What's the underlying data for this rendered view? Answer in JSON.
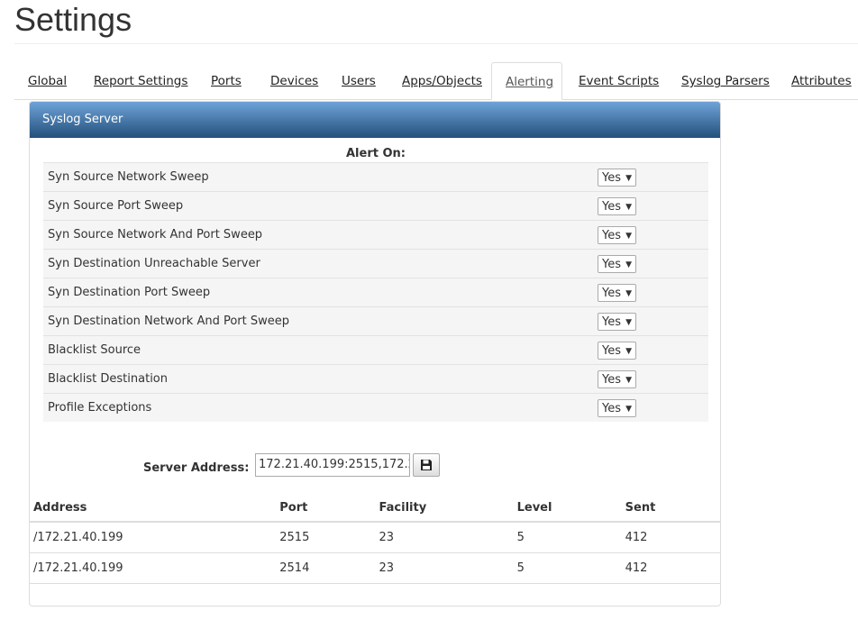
{
  "page_title": "Settings",
  "tabs": [
    "Global",
    "Report Settings",
    "Ports",
    "Devices",
    "Users",
    "Apps/Objects",
    "Alerting",
    "Event Scripts",
    "Syslog Parsers",
    "Attributes"
  ],
  "active_tab": "Alerting",
  "panel": {
    "title": "Syslog Server",
    "alert_on_label": "Alert On:",
    "alerts": [
      {
        "label": "Syn Source Network Sweep",
        "value": "Yes"
      },
      {
        "label": "Syn Source Port Sweep",
        "value": "Yes"
      },
      {
        "label": "Syn Source Network And Port Sweep",
        "value": "Yes"
      },
      {
        "label": "Syn Destination Unreachable Server",
        "value": "Yes"
      },
      {
        "label": "Syn Destination Port Sweep",
        "value": "Yes"
      },
      {
        "label": "Syn Destination Network And Port Sweep",
        "value": "Yes"
      },
      {
        "label": "Blacklist Source",
        "value": "Yes"
      },
      {
        "label": "Blacklist Destination",
        "value": "Yes"
      },
      {
        "label": "Profile Exceptions",
        "value": "Yes"
      }
    ],
    "server_address_label": "Server Address:",
    "server_address_value": "172.21.40.199:2515,172.2",
    "save_icon": "floppy-disk-icon",
    "table": {
      "headers": [
        "Address",
        "Port",
        "Facility",
        "Level",
        "Sent"
      ],
      "rows": [
        [
          "/172.21.40.199",
          "2515",
          "23",
          "5",
          "412"
        ],
        [
          "/172.21.40.199",
          "2514",
          "23",
          "5",
          "412"
        ]
      ]
    }
  }
}
